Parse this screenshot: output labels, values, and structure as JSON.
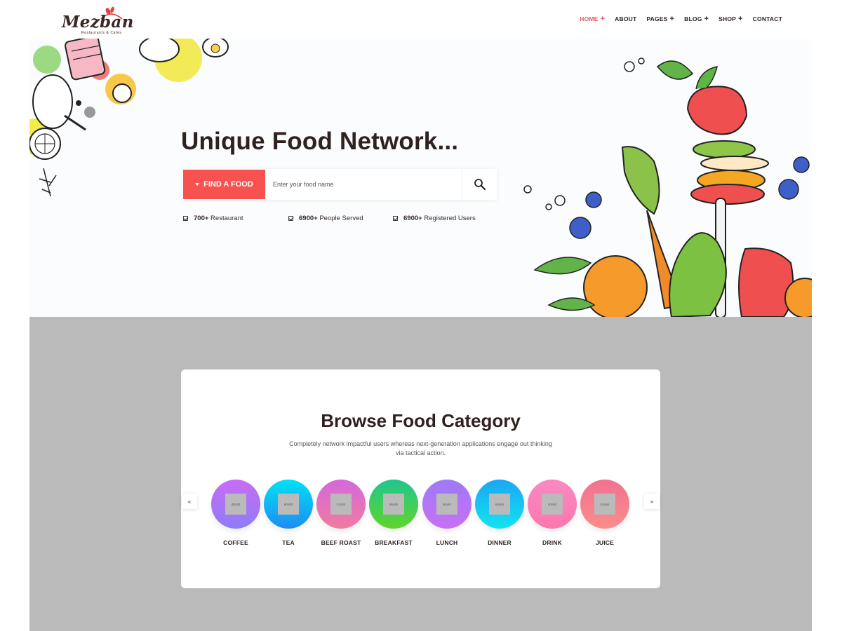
{
  "brand": {
    "name": "Mezban",
    "tagline": "Restaurants & Cafes"
  },
  "nav": {
    "items": [
      {
        "label": "HOME",
        "has_submenu": true,
        "active": true
      },
      {
        "label": "ABOUT",
        "has_submenu": false,
        "active": false
      },
      {
        "label": "PAGES",
        "has_submenu": true,
        "active": false
      },
      {
        "label": "BLOG",
        "has_submenu": true,
        "active": false
      },
      {
        "label": "SHOP",
        "has_submenu": true,
        "active": false
      },
      {
        "label": "CONTACT",
        "has_submenu": false,
        "active": false
      }
    ]
  },
  "hero": {
    "title": "Unique Food Network...",
    "search": {
      "button_label": "FIND A FOOD",
      "placeholder": "Enter your food name"
    },
    "stats": [
      {
        "value": "700+",
        "label": "Restaurant"
      },
      {
        "value": "6900+",
        "label": "People Served"
      },
      {
        "value": "6900+",
        "label": "Registered Users"
      }
    ]
  },
  "categories": {
    "title": "Browse Food Category",
    "description": "Completely network impactful users whereas next-generation applications engage out thinking via tactical action.",
    "prev_label": "«",
    "next_label": "»",
    "items": [
      {
        "label": "COFFEE",
        "image_size": "40x30",
        "gradient": [
          "#c86cf4",
          "#8e7cf6"
        ]
      },
      {
        "label": "TEA",
        "image_size": "60x50",
        "gradient": [
          "#00e1f5",
          "#1f8cf3"
        ]
      },
      {
        "label": "BEEF ROAST",
        "image_size": "51x30",
        "gradient": [
          "#d369db",
          "#f27a9e"
        ]
      },
      {
        "label": "BREAKFAST",
        "image_size": "56x45",
        "gradient": [
          "#20c68f",
          "#5fd52a"
        ]
      },
      {
        "label": "LUNCH",
        "image_size": "50x40",
        "gradient": [
          "#9d7af7",
          "#c870f4"
        ]
      },
      {
        "label": "DINNER",
        "image_size": "60x54",
        "gradient": [
          "#1aa7f4",
          "#13e3f0"
        ]
      },
      {
        "label": "DRINK",
        "image_size": "40x50",
        "gradient": [
          "#f98ac1",
          "#fd76ad"
        ]
      },
      {
        "label": "JUICE",
        "image_size": "52x50",
        "gradient": [
          "#f27191",
          "#fb8d8a"
        ]
      }
    ]
  },
  "colors": {
    "accent": "#f7524f",
    "text_dark": "#2f2120",
    "hero_bg": "#fafcfd",
    "section_bg": "#bababa"
  }
}
